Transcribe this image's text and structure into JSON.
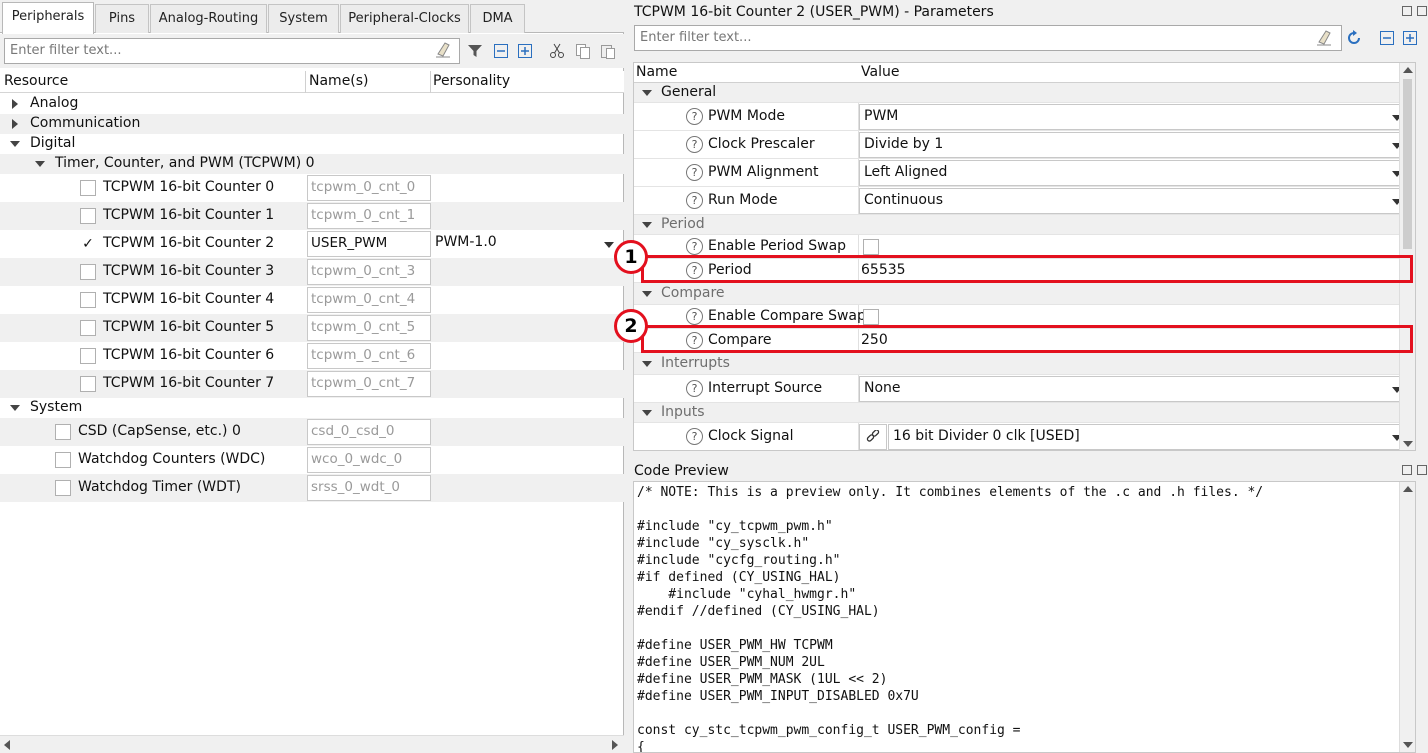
{
  "left": {
    "tabs": [
      "Peripherals",
      "Pins",
      "Analog-Routing",
      "System",
      "Peripheral-Clocks",
      "DMA"
    ],
    "filter_placeholder": "Enter filter text...",
    "columns": {
      "resource": "Resource",
      "names": "Name(s)",
      "personality": "Personality"
    },
    "tree": {
      "analog": "Analog",
      "communication": "Communication",
      "digital": "Digital",
      "tcpwm_group": "Timer, Counter, and PWM (TCPWM) 0",
      "counters": [
        {
          "label": "TCPWM 16-bit Counter 0",
          "name": "tcpwm_0_cnt_0",
          "checked": false,
          "personality": ""
        },
        {
          "label": "TCPWM 16-bit Counter 1",
          "name": "tcpwm_0_cnt_1",
          "checked": false,
          "personality": ""
        },
        {
          "label": "TCPWM 16-bit Counter 2",
          "name": "USER_PWM",
          "checked": true,
          "personality": "PWM-1.0"
        },
        {
          "label": "TCPWM 16-bit Counter 3",
          "name": "tcpwm_0_cnt_3",
          "checked": false,
          "personality": ""
        },
        {
          "label": "TCPWM 16-bit Counter 4",
          "name": "tcpwm_0_cnt_4",
          "checked": false,
          "personality": ""
        },
        {
          "label": "TCPWM 16-bit Counter 5",
          "name": "tcpwm_0_cnt_5",
          "checked": false,
          "personality": ""
        },
        {
          "label": "TCPWM 16-bit Counter 6",
          "name": "tcpwm_0_cnt_6",
          "checked": false,
          "personality": ""
        },
        {
          "label": "TCPWM 16-bit Counter 7",
          "name": "tcpwm_0_cnt_7",
          "checked": false,
          "personality": ""
        }
      ],
      "system": "System",
      "system_items": [
        {
          "label": "CSD (CapSense, etc.) 0",
          "name": "csd_0_csd_0"
        },
        {
          "label": "Watchdog Counters (WDC)",
          "name": "wco_0_wdc_0"
        },
        {
          "label": "Watchdog Timer (WDT)",
          "name": "srss_0_wdt_0"
        }
      ]
    }
  },
  "params": {
    "title": "TCPWM 16-bit Counter 2 (USER_PWM) - Parameters",
    "filter_placeholder": "Enter filter text...",
    "columns": {
      "name": "Name",
      "value": "Value"
    },
    "sections": {
      "general": "General",
      "period": "Period",
      "compare": "Compare",
      "interrupts": "Interrupts",
      "inputs": "Inputs"
    },
    "rows": {
      "pwm_mode": {
        "label": "PWM Mode",
        "value": "PWM"
      },
      "clock_prescaler": {
        "label": "Clock Prescaler",
        "value": "Divide by 1"
      },
      "pwm_alignment": {
        "label": "PWM Alignment",
        "value": "Left Aligned"
      },
      "run_mode": {
        "label": "Run Mode",
        "value": "Continuous"
      },
      "enable_period_swap": {
        "label": "Enable Period Swap"
      },
      "period": {
        "label": "Period",
        "value": "65535"
      },
      "enable_compare_swap": {
        "label": "Enable Compare Swap"
      },
      "compare": {
        "label": "Compare",
        "value": "250"
      },
      "interrupt_source": {
        "label": "Interrupt Source",
        "value": "None"
      },
      "clock_signal": {
        "label": "Clock Signal",
        "value": "16 bit Divider 0 clk [USED]"
      }
    },
    "help_glyph": "?",
    "callouts": [
      "1",
      "2"
    ]
  },
  "code_preview": {
    "title": "Code Preview",
    "text": "/* NOTE: This is a preview only. It combines elements of the .c and .h files. */\n\n#include \"cy_tcpwm_pwm.h\"\n#include \"cy_sysclk.h\"\n#include \"cycfg_routing.h\"\n#if defined (CY_USING_HAL)\n    #include \"cyhal_hwmgr.h\"\n#endif //defined (CY_USING_HAL)\n\n#define USER_PWM_HW TCPWM\n#define USER_PWM_NUM 2UL\n#define USER_PWM_MASK (1UL << 2)\n#define USER_PWM_INPUT_DISABLED 0x7U\n\nconst cy_stc_tcpwm_pwm_config_t USER_PWM_config =\n{"
  },
  "colors": {
    "callout": "#e3101e",
    "help_icon": "#555555",
    "link_icon": "#333333",
    "toolbar_blue": "#2a6fbf"
  }
}
